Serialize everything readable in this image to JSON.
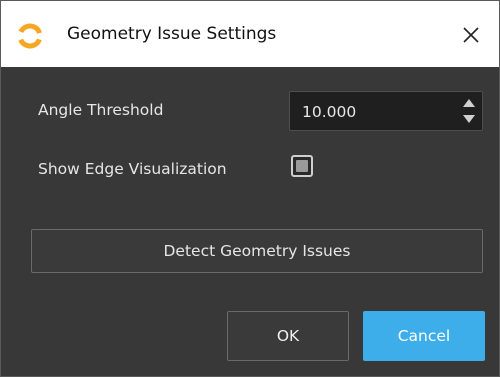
{
  "window": {
    "title": "Geometry Issue Settings",
    "app_icon": "app-logo-icon",
    "close_icon": "close-icon"
  },
  "form": {
    "angle_threshold_label": "Angle Threshold",
    "angle_threshold_value": "10.000",
    "show_edge_label": "Show Edge Visualization",
    "show_edge_checked": true
  },
  "buttons": {
    "detect_label": "Detect Geometry Issues",
    "ok_label": "OK",
    "cancel_label": "Cancel"
  },
  "colors": {
    "accent": "#3daee9",
    "background": "#383838",
    "titlebar": "#ffffff",
    "logo_orange": "#f5a623"
  }
}
